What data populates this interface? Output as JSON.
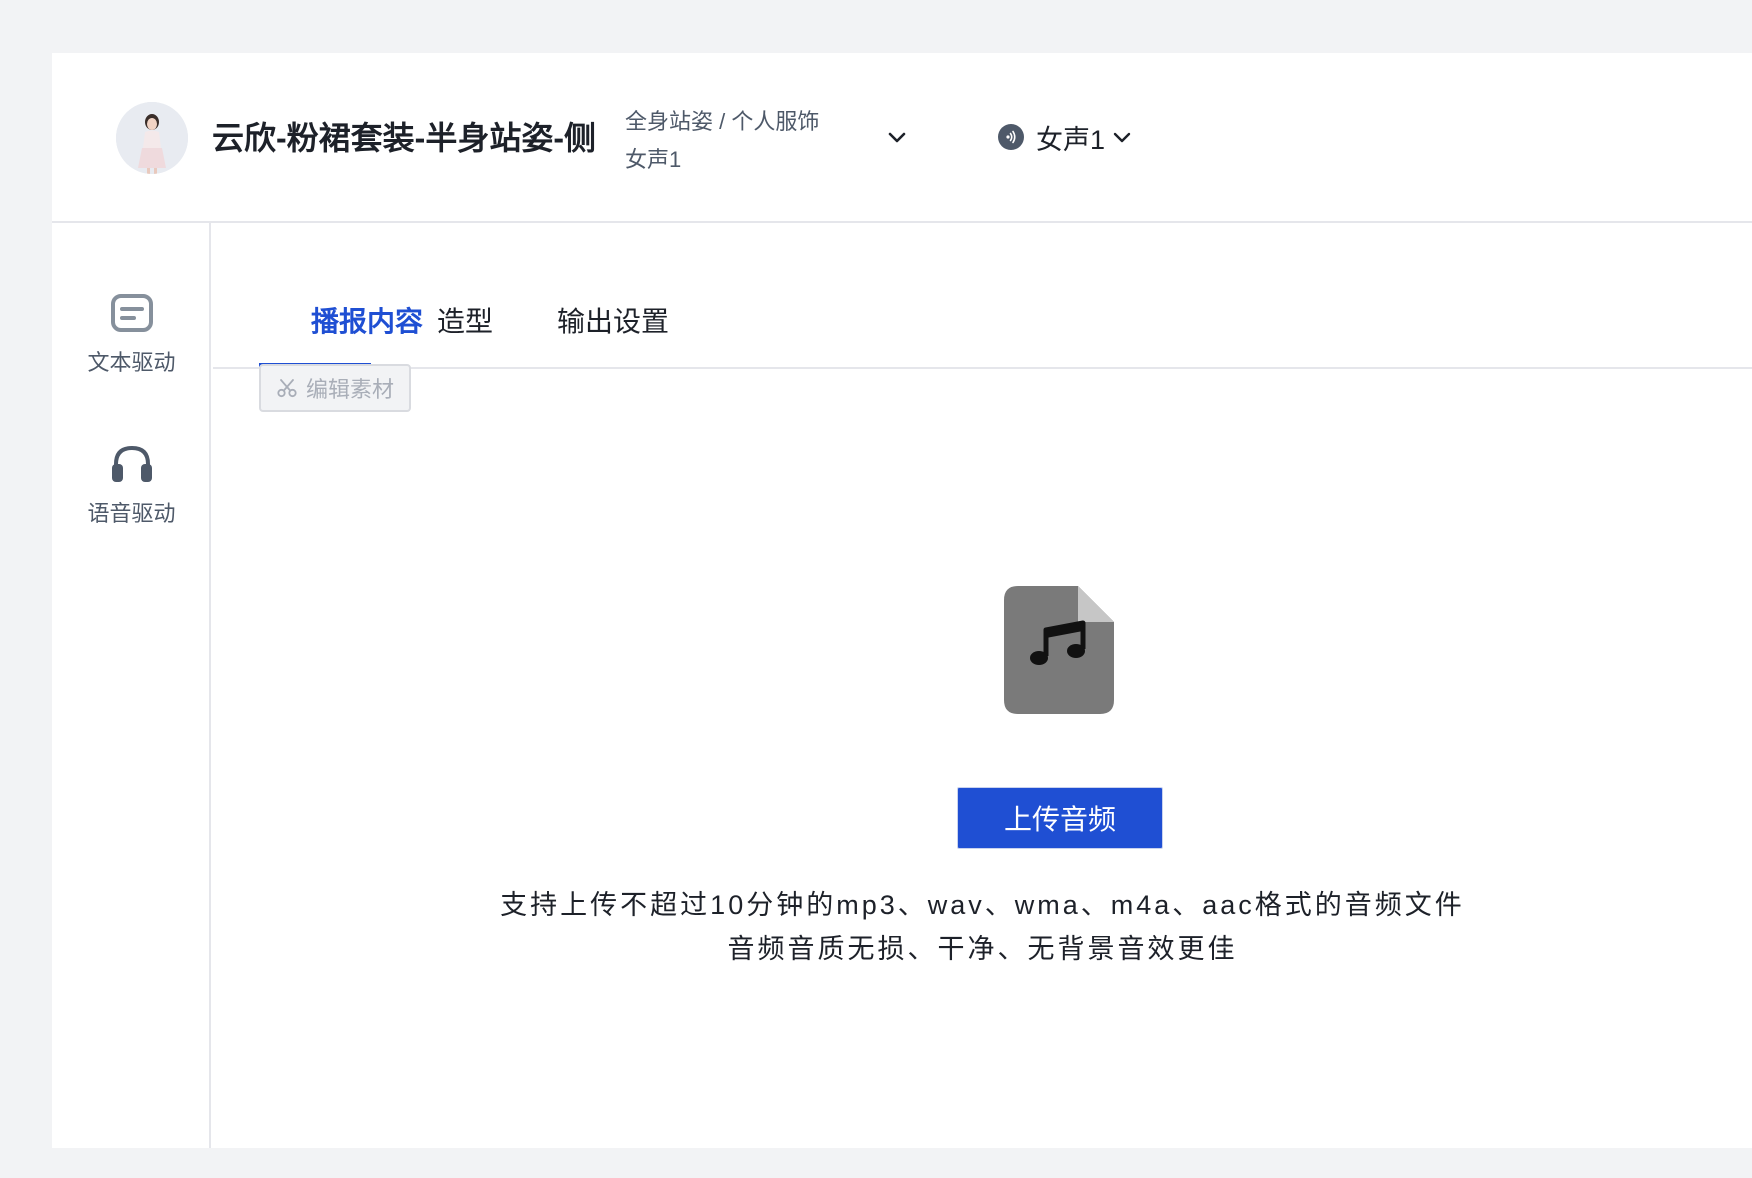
{
  "header": {
    "title": "云欣-粉裙套装-半身站姿-侧",
    "pose_type": "全身站姿 / 个人服饰",
    "voice_line": "女声1",
    "voice_selector_label": "女声1"
  },
  "sidebar": {
    "items": [
      {
        "label": "文本驱动",
        "icon": "message-square-icon"
      },
      {
        "label": "语音驱动",
        "icon": "headphones-icon"
      }
    ]
  },
  "tabs": [
    {
      "label": "播报内容",
      "active": true
    },
    {
      "label": "造型",
      "active": false
    },
    {
      "label": "输出设置",
      "active": false
    }
  ],
  "toolbar": {
    "edit_material_label": "编辑素材",
    "edit_material_disabled": true
  },
  "upload": {
    "button_label": "上传音频",
    "hint_line1": "支持上传不超过10分钟的mp3、wav、wma、m4a、aac格式的音频文件",
    "hint_line2": "音频音质无损、干净、无背景音效更佳"
  },
  "colors": {
    "accent": "#1f4fd3",
    "background": "#f2f3f5",
    "panel": "#ffffff",
    "text_primary": "#1d2129",
    "text_secondary": "#4e5969",
    "disabled_text": "#a9aeb8"
  }
}
